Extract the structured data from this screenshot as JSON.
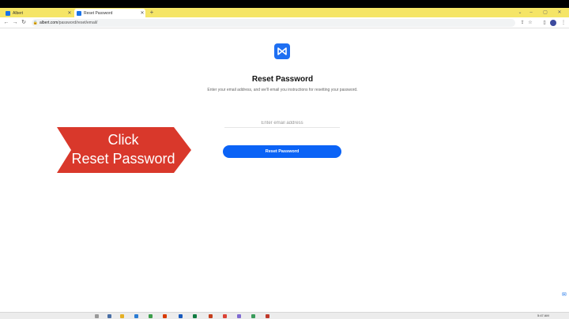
{
  "browser": {
    "tabs": [
      {
        "label": "Albert"
      },
      {
        "label": "Reset Password"
      }
    ],
    "new_tab": "+",
    "url_domain": "albert.com",
    "url_path": "/password/reset/email/"
  },
  "page": {
    "title": "Reset Password",
    "subtitle": "Enter your email address, and we'll email you instructions for resetting your password.",
    "email_placeholder": "Enter email address",
    "submit_label": "Reset Password"
  },
  "annotation": {
    "line1": "Click",
    "line2": "Reset Password",
    "color": "#d9382b"
  },
  "taskbar": {
    "clock": "5:47 AM"
  },
  "colors": {
    "accent": "#0b63f6",
    "tabstrip": "#f5e566"
  }
}
